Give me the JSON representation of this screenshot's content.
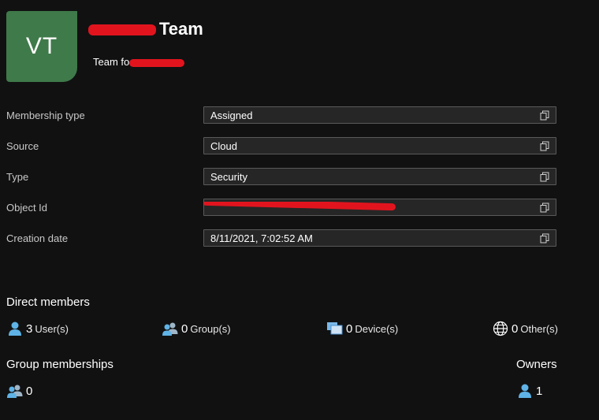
{
  "header": {
    "avatar_initials": "VT",
    "title_suffix": "Team",
    "subtitle_prefix": "Team fo"
  },
  "properties": [
    {
      "label": "Membership type",
      "value": "Assigned"
    },
    {
      "label": "Source",
      "value": "Cloud"
    },
    {
      "label": "Type",
      "value": "Security"
    },
    {
      "label": "Object Id",
      "value": ""
    },
    {
      "label": "Creation date",
      "value": "8/11/2021, 7:02:52 AM"
    }
  ],
  "direct_members": {
    "title": "Direct members",
    "users": {
      "count": "3",
      "unit": "User(s)"
    },
    "groups": {
      "count": "0",
      "unit": "Group(s)"
    },
    "devices": {
      "count": "0",
      "unit": "Device(s)"
    },
    "others": {
      "count": "0",
      "unit": "Other(s)"
    }
  },
  "group_memberships": {
    "title": "Group memberships",
    "count": "0"
  },
  "owners": {
    "title": "Owners",
    "count": "1"
  },
  "colors": {
    "avatar": "#3f7a4a",
    "background": "#111112",
    "field": "#262626",
    "redaction": "#e1141e"
  }
}
